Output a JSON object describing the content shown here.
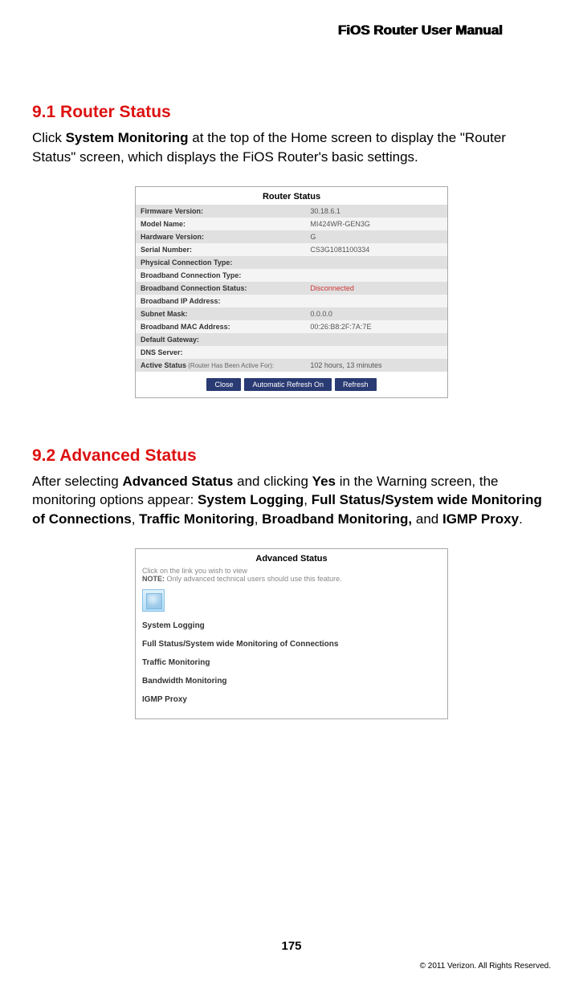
{
  "header": "FiOS Router User Manual",
  "sec1": {
    "heading": "9.1  Router Status",
    "p_before": "Click ",
    "p_bold1": "System Monitoring",
    "p_after": " at the top of the Home screen to display the \"Router Status\" screen, which displays the FiOS Router's basic settings."
  },
  "router_status": {
    "title": "Router Status",
    "rows": [
      {
        "label": "Firmware Version:",
        "value": "30.18.6.1"
      },
      {
        "label": "Model Name:",
        "value": "MI424WR-GEN3G"
      },
      {
        "label": "Hardware Version:",
        "value": "G"
      },
      {
        "label": "Serial Number:",
        "value": "CS3G1081100334"
      },
      {
        "label": "Physical Connection Type:",
        "value": ""
      },
      {
        "label": "Broadband Connection Type:",
        "value": ""
      },
      {
        "label": "Broadband Connection Status:",
        "value": "Disconnected",
        "red": true
      },
      {
        "label": "Broadband IP Address:",
        "value": ""
      },
      {
        "label": "Subnet Mask:",
        "value": "0.0.0.0"
      },
      {
        "label": "Broadband MAC Address:",
        "value": "00:26:B8:2F:7A:7E"
      },
      {
        "label": "Default Gateway:",
        "value": ""
      },
      {
        "label": "DNS Server:",
        "value": ""
      },
      {
        "label": "Active Status",
        "sub": " (Router Has Been Active For):",
        "value": "102 hours, 13 minutes"
      }
    ],
    "buttons": [
      "Close",
      "Automatic Refresh On",
      "Refresh"
    ]
  },
  "sec2": {
    "heading": "9.2  Advanced Status",
    "p1": "After selecting ",
    "b1": "Advanced Status",
    "p2": " and clicking ",
    "b2": "Yes",
    "p3": " in the Warning screen, the monitoring options appear: ",
    "b3": "System Logging",
    "p4": ", ",
    "b4": "Full Status/System wide Monitoring of Connections",
    "p5": ", ",
    "b5": "Traffic Monitoring",
    "p6": ", ",
    "b6": "Broadband Monitoring,",
    "p7": " and ",
    "b7": "IGMP Proxy",
    "p8": "."
  },
  "adv_status": {
    "title": "Advanced Status",
    "sub": "Click on the link you wish to view",
    "note_b": "NOTE:",
    "note": " Only advanced technical users should use this feature.",
    "links": [
      "System Logging",
      "Full Status/System wide Monitoring of Connections",
      "Traffic Monitoring",
      "Bandwidth Monitoring",
      "IGMP Proxy"
    ]
  },
  "page": "175",
  "copyright": "© 2011 Verizon. All Rights Reserved."
}
